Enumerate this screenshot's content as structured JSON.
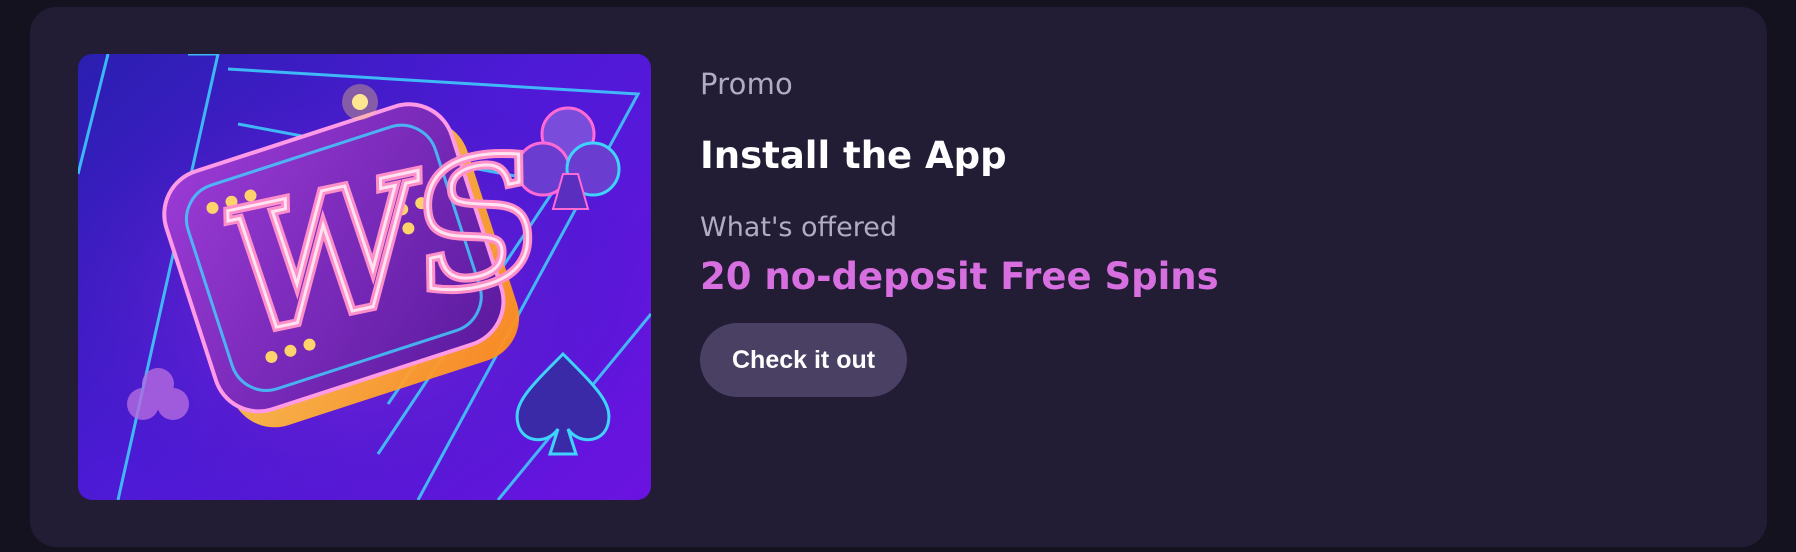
{
  "promo": {
    "label": "Promo",
    "title": "Install the App",
    "offered_label": "What's offered",
    "offer": "20 no-deposit Free Spins",
    "cta_label": "Check it out",
    "hero_logo_text": "WS"
  },
  "colors": {
    "page_bg": "#15121f",
    "card_bg": "#221c34",
    "accent_pink": "#d86fe1",
    "button_bg": "#4a4064",
    "muted_text": "#b3abc5"
  }
}
